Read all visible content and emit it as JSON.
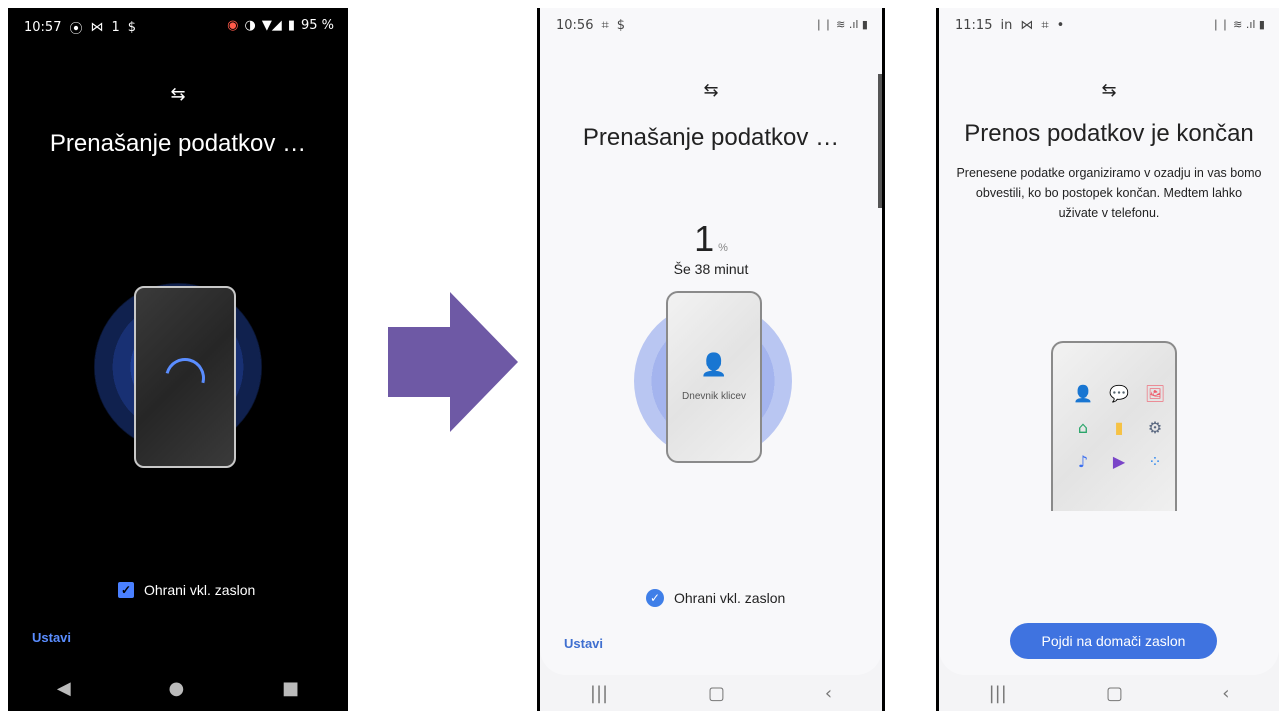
{
  "screen1": {
    "status": {
      "time": "10:57",
      "left_icons": [
        "⦿",
        "⋈",
        "1",
        "$"
      ],
      "right_icons": [
        "◉",
        "◑",
        "▼◢",
        "▮"
      ],
      "battery": "95 %"
    },
    "transfer_icon": "⇆",
    "title": "Prenašanje podatkov …",
    "keep_screen_label": "Ohrani vkl. zaslon",
    "stop_label": "Ustavi",
    "nav": {
      "back": "◀",
      "home": "●",
      "recents": "■"
    }
  },
  "screen2": {
    "status": {
      "time": "10:56",
      "left_icons": [
        "⌗",
        "$"
      ],
      "right_icons": "❘❘ ≋ .ıl ▮"
    },
    "transfer_icon": "⇆",
    "title": "Prenašanje podatkov …",
    "percent_value": "1",
    "percent_unit": "%",
    "time_remaining": "Še 38 minut",
    "item_icon": "👤",
    "item_label": "Dnevnik klicev",
    "keep_screen_label": "Ohrani vkl. zaslon",
    "stop_label": "Ustavi",
    "nav": {
      "recents": "|||",
      "home": "▢",
      "back": "‹"
    }
  },
  "screen3": {
    "status": {
      "time": "11:15",
      "left_icons": [
        "in",
        "⋈",
        "⌗",
        "•"
      ],
      "right_icons": "❘❘ ≋ .ıl ▮"
    },
    "transfer_icon": "⇆",
    "title": "Prenos podatkov je končan",
    "description": "Prenesene podatke organiziramo v ozadju in vas bomo obvestili, ko bo postopek končan. Medtem lahko uživate v telefonu.",
    "apps": [
      {
        "name": "contacts",
        "glyph": "👤",
        "color": "#f08a3c"
      },
      {
        "name": "messages",
        "glyph": "💬",
        "color": "#3b8ff0"
      },
      {
        "name": "gallery",
        "glyph": "🖼",
        "color": "#ef5a6a"
      },
      {
        "name": "home",
        "glyph": "⌂",
        "color": "#2aa56a"
      },
      {
        "name": "documents",
        "glyph": "▮",
        "color": "#f6c244"
      },
      {
        "name": "settings",
        "glyph": "⚙",
        "color": "#5a6880"
      },
      {
        "name": "music",
        "glyph": "♪",
        "color": "#3b6ff0"
      },
      {
        "name": "video",
        "glyph": "▶",
        "color": "#7a45c8"
      },
      {
        "name": "apps",
        "glyph": "⁘",
        "color": "#3b8ff0"
      }
    ],
    "home_button_label": "Pojdi na domači zaslon",
    "nav": {
      "recents": "|||",
      "home": "▢",
      "back": "‹"
    }
  },
  "colors": {
    "arrow": "#6e59a5",
    "accent_blue": "#3f73e0"
  }
}
